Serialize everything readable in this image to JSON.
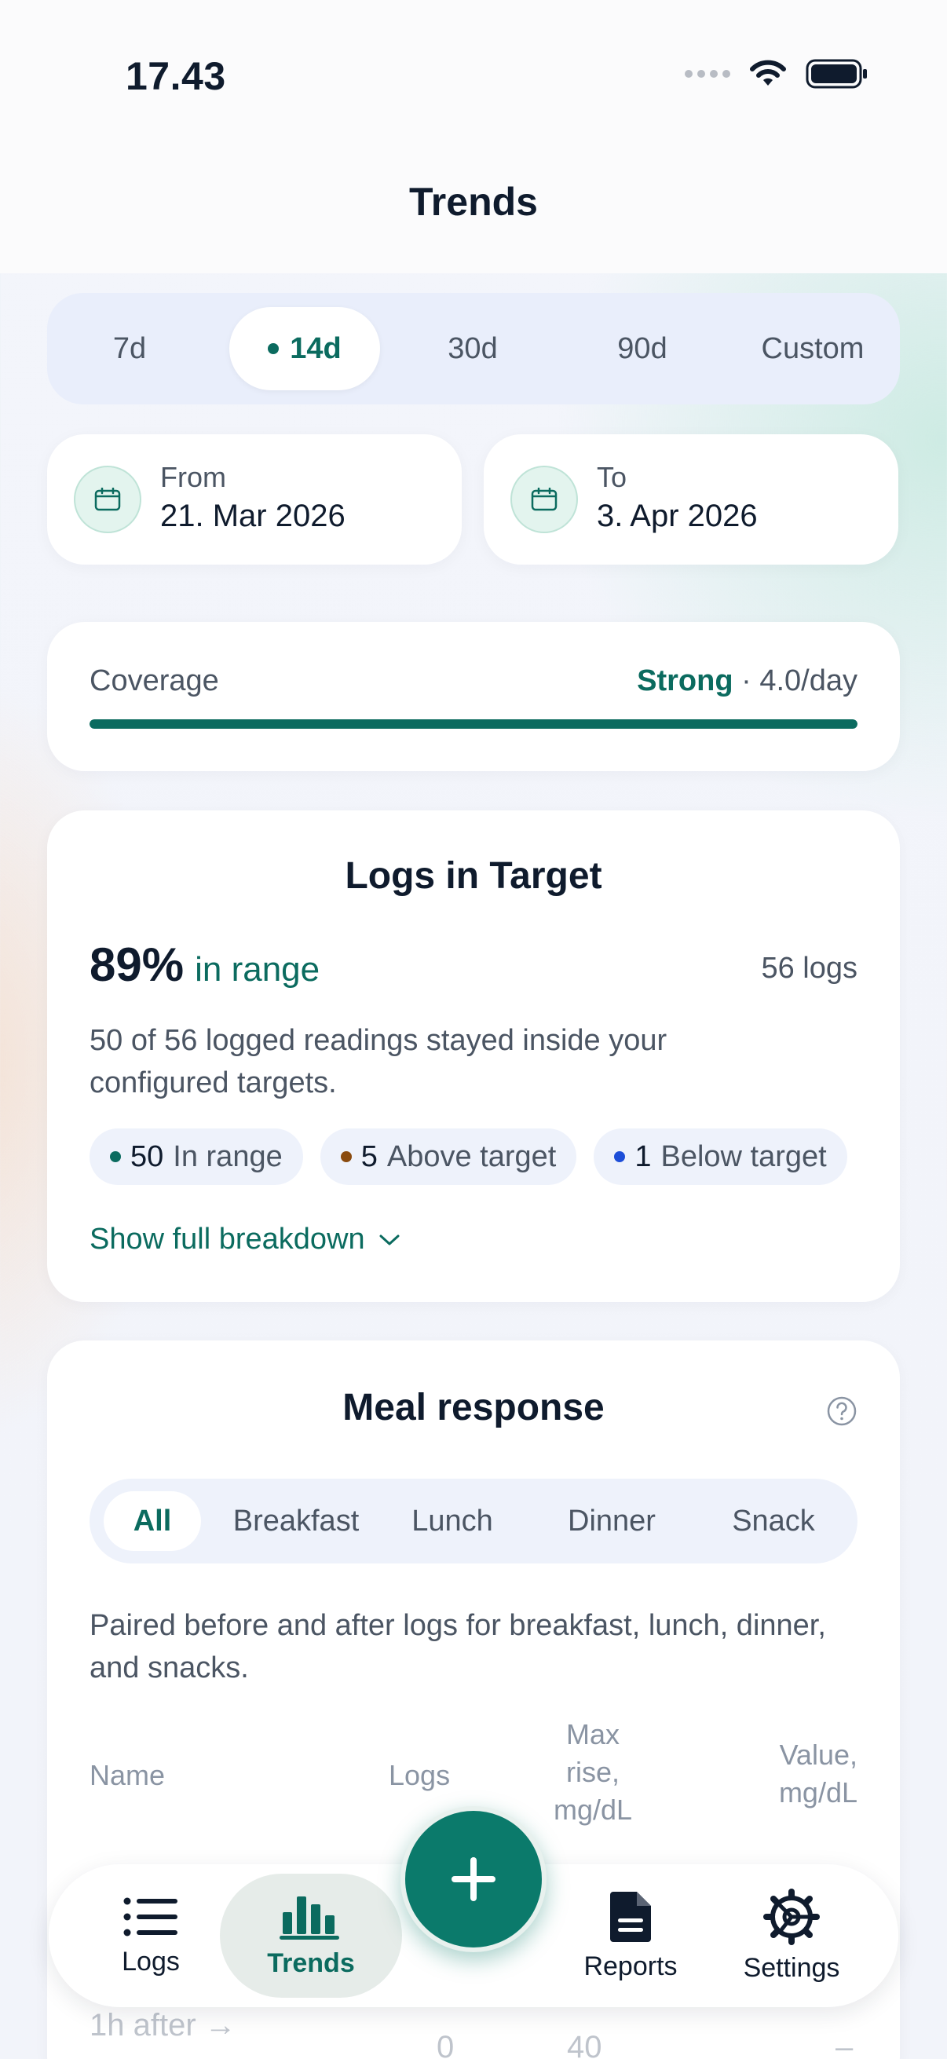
{
  "status": {
    "time": "17.43"
  },
  "nav": {
    "title": "Trends"
  },
  "range": {
    "options": [
      "7d",
      "14d",
      "30d",
      "90d",
      "Custom"
    ],
    "selected": "14d"
  },
  "dates": {
    "from_label": "From",
    "from_value": "21. Mar 2026",
    "to_label": "To",
    "to_value": "3. Apr 2026"
  },
  "coverage": {
    "label": "Coverage",
    "strength": "Strong",
    "separator": "·",
    "rate": "4.0/day",
    "level_percent": 100
  },
  "logs_target": {
    "title": "Logs in Target",
    "percent": "89%",
    "percent_suffix": "in range",
    "count": "56 logs",
    "description": "50 of 56 logged readings stayed inside your configured targets.",
    "chips": [
      {
        "count": "50",
        "label": "In range",
        "color": "#0b6b5f"
      },
      {
        "count": "5",
        "label": "Above target",
        "color": "#8a4b0f"
      },
      {
        "count": "1",
        "label": "Below target",
        "color": "#1d4ed8"
      }
    ],
    "show_link": "Show full breakdown"
  },
  "meal": {
    "title": "Meal response",
    "tabs": [
      "All",
      "Breakfast",
      "Lunch",
      "Dinner",
      "Snack"
    ],
    "selected_tab": "All",
    "description": "Paired before and after logs for breakfast, lunch, dinner, and snacks.",
    "columns": {
      "name": "Name",
      "logs": "Logs",
      "max_rise": "Max\nrise,\nmg/dL",
      "value": "Value,\nmg/dL"
    },
    "partial_row": {
      "name": "1h after →",
      "logs": "0",
      "max_rise": "40",
      "value": "–"
    }
  },
  "tabbar": {
    "items": [
      {
        "label": "Logs",
        "icon": "list-icon"
      },
      {
        "label": "Trends",
        "icon": "bar-chart-icon"
      },
      {
        "label": "Reports",
        "icon": "document-icon"
      },
      {
        "label": "Settings",
        "icon": "gear-icon"
      }
    ],
    "active": "Trends",
    "fab_icon": "plus-icon"
  }
}
